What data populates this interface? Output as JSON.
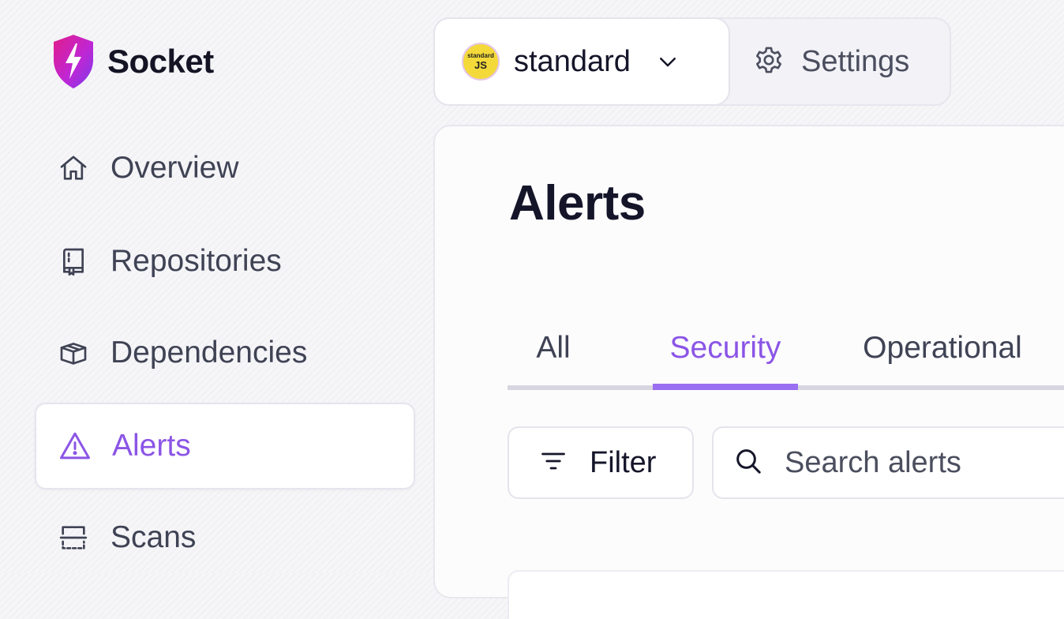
{
  "brand": {
    "name": "Socket",
    "accent_color": "#8b55e6",
    "logo_colors": [
      "#e11d8a",
      "#a21caf",
      "#7c3aed"
    ]
  },
  "sidebar": {
    "items": [
      {
        "label": "Overview",
        "icon": "home-icon",
        "active": false
      },
      {
        "label": "Repositories",
        "icon": "book-icon",
        "active": false
      },
      {
        "label": "Dependencies",
        "icon": "package-icon",
        "active": false
      },
      {
        "label": "Alerts",
        "icon": "warning-triangle-icon",
        "active": true
      },
      {
        "label": "Scans",
        "icon": "scan-icon",
        "active": false
      }
    ]
  },
  "topbar": {
    "org": {
      "name": "standard",
      "avatar_small": "standard",
      "avatar_big": "JS",
      "avatar_color": "#f4d93a"
    },
    "settings_label": "Settings"
  },
  "main": {
    "title": "Alerts",
    "tabs": [
      {
        "label": "All",
        "active": false
      },
      {
        "label": "Security",
        "active": true
      },
      {
        "label": "Operational",
        "active": false
      }
    ],
    "filter_label": "Filter",
    "search_placeholder": "Search alerts"
  }
}
